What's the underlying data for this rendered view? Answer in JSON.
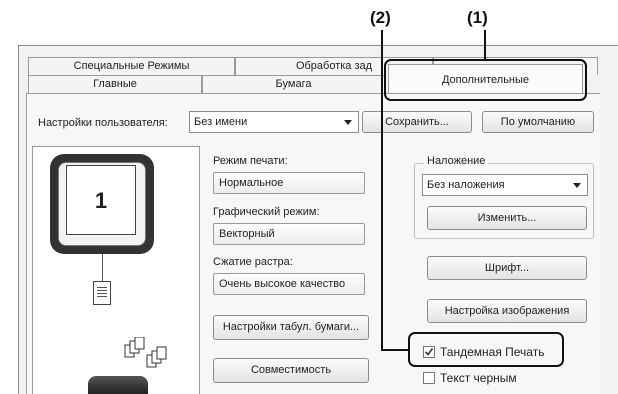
{
  "callouts": {
    "first": "(1)",
    "second": "(2)"
  },
  "tabs": {
    "row1": [
      "Специальные Режимы",
      "Обработка зад"
    ],
    "row2": [
      "Главные",
      "Бумага",
      "Дополнительные"
    ]
  },
  "user_settings": {
    "label": "Настройки пользователя:",
    "value": "Без имени",
    "save_button": "Сохранить...",
    "default_button": "По умолчанию"
  },
  "preview": {
    "page_number": "1"
  },
  "print_mode": {
    "label": "Режим печати:",
    "value": "Нормальное"
  },
  "graphic_mode": {
    "label": "Графический режим:",
    "value": "Векторный"
  },
  "raster_compression": {
    "label": "Сжатие растра:",
    "value": "Очень высокое качество"
  },
  "tab_paper_button": "Настройки табул. бумаги...",
  "compatibility_button": "Совместимость",
  "overlay": {
    "label": "Наложение",
    "value": "Без наложения",
    "edit_button": "Изменить..."
  },
  "font_button": "Шрифт...",
  "image_adjust_button": "Настройка изображения",
  "tandem_print": {
    "label": "Тандемная Печать",
    "checked": true
  },
  "text_black": {
    "label": "Текст черным",
    "checked": false
  }
}
